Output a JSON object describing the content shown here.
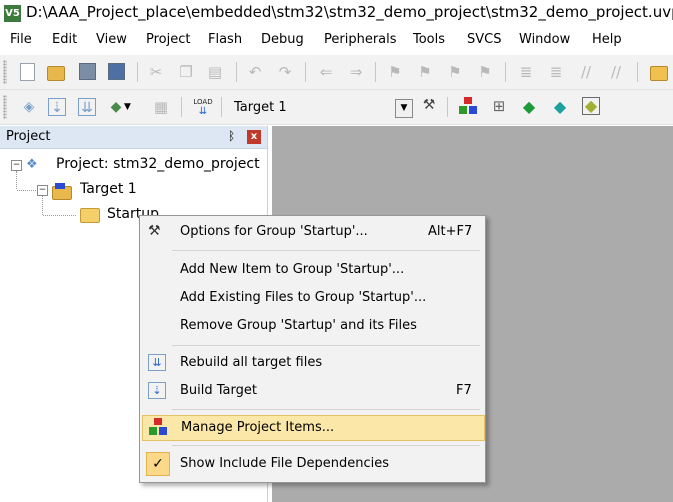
{
  "window": {
    "title": "D:\\AAA_Project_place\\embedded\\stm32\\stm32_demo_project\\stm32_demo_project.uvp",
    "app_icon": "V5"
  },
  "menubar": [
    "File",
    "Edit",
    "View",
    "Project",
    "Flash",
    "Debug",
    "Peripherals",
    "Tools",
    "SVCS",
    "Window",
    "Help"
  ],
  "toolbar2": {
    "load_label": "LOAD",
    "target_select": "Target 1"
  },
  "project_panel": {
    "title": "Project",
    "pin_icon": "pin-icon",
    "close_label": "x",
    "tree": {
      "project": "Project: stm32_demo_project",
      "target": "Target 1",
      "group": "Startup",
      "expand_symbol": "−"
    }
  },
  "context_menu": {
    "options_label": "Options for Group 'Startup'...",
    "options_shortcut": "Alt+F7",
    "add_new_label": "Add New  Item to Group 'Startup'...",
    "add_existing_label": "Add Existing Files to Group 'Startup'...",
    "remove_label": "Remove Group 'Startup' and its Files",
    "rebuild_label": "Rebuild all target files",
    "build_label": "Build Target",
    "build_shortcut": "F7",
    "manage_label": "Manage Project Items...",
    "show_deps_label": "Show Include File Dependencies",
    "show_deps_checked": "✓"
  },
  "colors": {
    "menu_highlight": "#fbe7a8",
    "panel_header": "#dde7f3",
    "work_area": "#ababab"
  }
}
